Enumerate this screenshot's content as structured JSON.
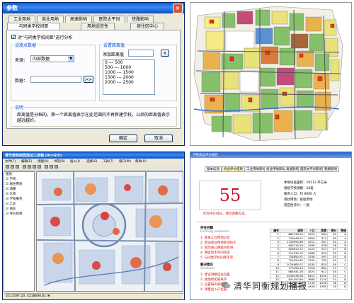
{
  "dialog": {
    "title": "参数",
    "close_label": "×",
    "tabs_row1": [
      "工业用地",
      "商业用地",
      "高速影响",
      "医院太平间",
      "铁路影响"
    ],
    "tabs_row2": [
      "与同类学校间距",
      "用地适宜性",
      "居住区中心"
    ],
    "enable_label": "对\"与同类学校间距\"进行分析",
    "enable_checked": "✓",
    "group_source_title": "设施点数据",
    "source_label": "来源：",
    "source_value": "内部数据",
    "data_label": "数据：",
    "browse_label": ">>",
    "group_distance_title": "设置距离值",
    "add_distance_label": "添加距离值",
    "add_button": "+",
    "distance_list": [
      "0 --- 500",
      "500 --- 1000",
      "1000 --- 1500",
      "1500 --- 2000",
      "2000 --- 2500"
    ],
    "group_note_title": "说明",
    "note_text": "距离值是分档的，第一个距离值表示在此范围内不再新建学校，以后的距离值表示越远越好。",
    "ok_label": "确定",
    "cancel_label": "取消"
  },
  "gis_window": {
    "title": "清华规划校园选址工具箱 (ArcGIS)",
    "menu": [
      "文件(F)",
      "编辑(E)",
      "视图(V)",
      "书签(B)",
      "插入(I)",
      "选择(S)",
      "工具(T)",
      "窗口(W)",
      "帮助(H)"
    ],
    "toc_items": [
      "图层",
      "☑ 学校",
      "☑ 居住用地",
      "☑ 道路",
      "☑ 水系",
      "☑ 学校服务",
      "☑ 工业",
      "☑ 商业",
      "☑ 评价结果"
    ],
    "status": "3213597.20, 4218686.61 米"
  },
  "report_window": {
    "title": "学校选址评价报告",
    "tabs": [
      "基本信息",
      "综合评价结果",
      "工业用地影响",
      "商业用地影响",
      "高速影响",
      "医院太平间影响",
      "铁路影响",
      "与同类学校间距",
      "用地适宜性"
    ],
    "score": "55",
    "score_caption": "综合评价得分，建议调整方案。",
    "info_lines": [
      "本地块总面积：10512 平方米",
      "规划学校规模：24班",
      "服务人口：约 9000 人",
      "现状用地：居住用地",
      "适宜性评价：一般"
    ],
    "problems_title": "存在问题",
    "problems_sub": "Existing problems",
    "problems": [
      "1. 距离工业用地过近",
      "2. 周边商业用地影响较大",
      "3. 受高速公路噪声影响",
      "4. 距医院太平间较近",
      "5. 与同类学校间距不足"
    ],
    "solutions_title": "解决意见",
    "solutions_sub": "Solutions",
    "solutions": [
      "1. 建议调整选址位置",
      "2. 增加绿化隔离带",
      "3. 设置隔声屏障",
      "4. 调整出入口位置",
      "5. 合理布局校舍"
    ],
    "table_headers": [
      "编号",
      "面积",
      "人口",
      "距离",
      "得分",
      "等级"
    ],
    "table_rows": [
      [
        "1",
        "884736.24",
        "4224",
        "284",
        "64",
        "A"
      ],
      [
        "2",
        "726448.01",
        "3850",
        "312",
        "62",
        "A"
      ],
      [
        "3",
        "1126594.86",
        "4912",
        "267",
        "61",
        "A"
      ],
      [
        "4",
        "694218.39",
        "3466",
        "458",
        "58",
        "B"
      ],
      [
        "5",
        "928614.72",
        "4120",
        "521",
        "57",
        "B"
      ],
      [
        "6",
        "712735.70",
        "2988",
        "633",
        "55",
        "B"
      ],
      [
        "7",
        "734650.31",
        "3256",
        "591",
        "53",
        "B"
      ],
      [
        "8",
        "724450.82",
        "3102",
        "702",
        "51",
        "C"
      ],
      [
        "9",
        "1024685.07",
        "4530",
        "820",
        "49",
        "C"
      ],
      [
        "10",
        "773256.44",
        "3318",
        "884",
        "47",
        "C"
      ],
      [
        "11",
        "684931.26",
        "2874",
        "912",
        "45",
        "C"
      ],
      [
        "12",
        "2056236.38",
        "6412",
        "1035",
        "43",
        "C"
      ],
      [
        "13",
        "831457.89",
        "3660",
        "1120",
        "41",
        "D"
      ],
      [
        "14",
        "652120.15",
        "2730",
        "1248",
        "38",
        "D"
      ],
      [
        "15",
        "1012584.67",
        "4408",
        "1380",
        "35",
        "D"
      ]
    ]
  },
  "watermark": "清华同衡规划播报",
  "colors": {
    "accent_red": "#d01010",
    "title_blue": "#0a5fd8",
    "xp_face": "#ece9d8"
  }
}
